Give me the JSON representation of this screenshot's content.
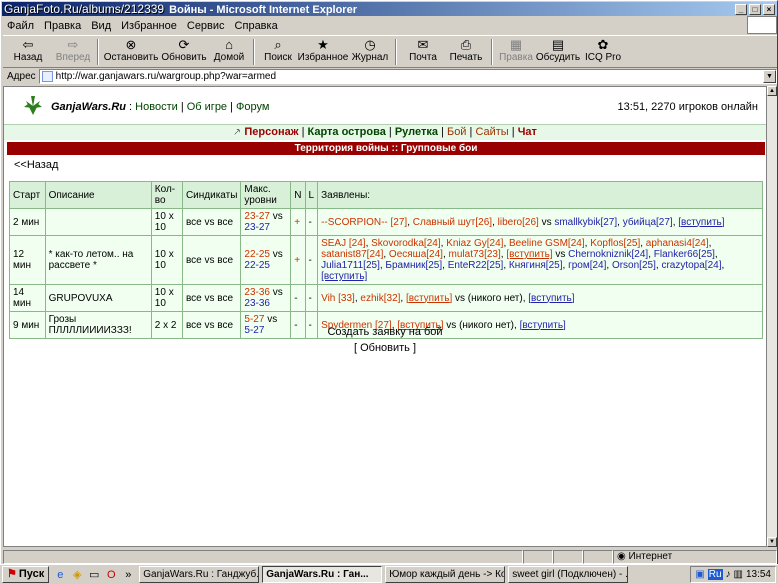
{
  "watermark": "GanjaFoto.Ru/albums/212339",
  "window": {
    "title": "Войны - Microsoft Internet Explorer"
  },
  "menu": [
    "Файл",
    "Правка",
    "Вид",
    "Избранное",
    "Сервис",
    "Справка"
  ],
  "toolbar": [
    {
      "label": "Назад",
      "icon": "back-arrow-icon",
      "glyph": "⇦",
      "enabled": true
    },
    {
      "label": "Вперед",
      "icon": "forward-arrow-icon",
      "glyph": "⇨",
      "enabled": false
    },
    {
      "label": "Остановить",
      "icon": "stop-icon",
      "glyph": "⊗",
      "enabled": true
    },
    {
      "label": "Обновить",
      "icon": "refresh-icon",
      "glyph": "⟳",
      "enabled": true
    },
    {
      "label": "Домой",
      "icon": "home-icon",
      "glyph": "⌂",
      "enabled": true
    },
    {
      "label": "Поиск",
      "icon": "search-icon",
      "glyph": "⌕",
      "enabled": true
    },
    {
      "label": "Избранное",
      "icon": "favorites-icon",
      "glyph": "★",
      "enabled": true
    },
    {
      "label": "Журнал",
      "icon": "history-icon",
      "glyph": "◷",
      "enabled": true
    },
    {
      "label": "Почта",
      "icon": "mail-icon",
      "glyph": "✉",
      "enabled": true
    },
    {
      "label": "Печать",
      "icon": "print-icon",
      "glyph": "⎙",
      "enabled": true
    },
    {
      "label": "Правка",
      "icon": "edit-icon",
      "glyph": "▦",
      "enabled": false
    },
    {
      "label": "Обсудить",
      "icon": "discuss-icon",
      "glyph": "▤",
      "enabled": true
    },
    {
      "label": "ICQ Pro",
      "icon": "icq-icon",
      "glyph": "✿",
      "enabled": true
    }
  ],
  "address": {
    "label": "Адрес",
    "url": "http://war.ganjawars.ru/wargroup.php?war=armed"
  },
  "site": {
    "name": "GanjaWars.Ru",
    "links": [
      "Новости",
      "Об игре",
      "Форум"
    ],
    "clock": "13:51, 2270 игроков онлайн",
    "nav": [
      "Персонаж",
      "Карта острова",
      "Рулетка",
      "Бой",
      "Сайты",
      "Чат"
    ],
    "page_title": "Территория войны :: Групповые бои",
    "back": "<<Назад",
    "create": "Создать заявку на бой",
    "refresh": "[ Обновить ]"
  },
  "table": {
    "headers": [
      "Старт",
      "Описание",
      "Кол-во",
      "Синдикаты",
      "Макс. уровни",
      "N",
      "L",
      "Заявлены:"
    ],
    "rows": [
      {
        "start": "2 мин",
        "desc": "",
        "count": "10 x 10",
        "synd": "все vs все",
        "lv_a": "23-27",
        "lv_b": "23-27",
        "n": "+",
        "l": "-",
        "team_a": [
          "--SCORPION-- [27]",
          "Славный шут[26]",
          "libero[26]"
        ],
        "team_b": [
          "smallkybik[27]",
          "убийца[27]"
        ],
        "join_a": false,
        "join_b": true,
        "none_b": false
      },
      {
        "start": "12 мин",
        "desc": "* как-то летом.. на рассвете *",
        "count": "10 x 10",
        "synd": "все vs все",
        "lv_a": "22-25",
        "lv_b": "22-25",
        "n": "+",
        "l": "-",
        "team_a": [
          "SEAJ [24]",
          "Skovorodka[24]",
          "Kniaz Gy[24]",
          "Beeline GSM[24]",
          "Kopflos[25]",
          "aphanasi4[24]",
          "satanist87[24]",
          "Оесяша[24]",
          "mulat73[23]"
        ],
        "team_b": [
          "Chernokniznik[24]",
          "Flanker66[25]",
          "Julia1711[25]",
          "Брамник[25]",
          "EnteR22[25]",
          "Княгиня[25]",
          "гром[24]",
          "Orson[25]",
          "crazytopa[24]"
        ],
        "join_a": true,
        "join_b": true,
        "none_b": false
      },
      {
        "start": "14 мин",
        "desc": "GRUPOVUXA",
        "count": "10 x 10",
        "synd": "все vs все",
        "lv_a": "23-36",
        "lv_b": "23-36",
        "n": "-",
        "l": "-",
        "team_a": [
          "Vih [33]",
          "ezhik[32]"
        ],
        "team_b": [],
        "join_a": true,
        "join_b": true,
        "none_b": true
      },
      {
        "start": "9 мин",
        "desc": "Грозы ПЛЛЛЛИИИИЗЗЗ!",
        "count": "2 x 2",
        "synd": "все vs все",
        "lv_a": "5-27",
        "lv_b": "5-27",
        "n": "-",
        "l": "-",
        "team_a": [
          "Spydermen [27]"
        ],
        "team_b": [],
        "join_a": true,
        "join_b": true,
        "none_b": true
      }
    ],
    "vs": "vs",
    "join": "[вступить]",
    "none": "(никого нет)"
  },
  "status": {
    "zone": "Интернет"
  },
  "taskbar": {
    "start": "Пуск",
    "tasks": [
      "GanjaWars.Ru : Ганджуб...",
      "GanjaWars.Ru : Ган...",
      "Юмор каждый день -> Ко...",
      "sweet girl (Подключен) - ..."
    ],
    "active": 1,
    "lang": "Ru",
    "time": "13:54"
  }
}
